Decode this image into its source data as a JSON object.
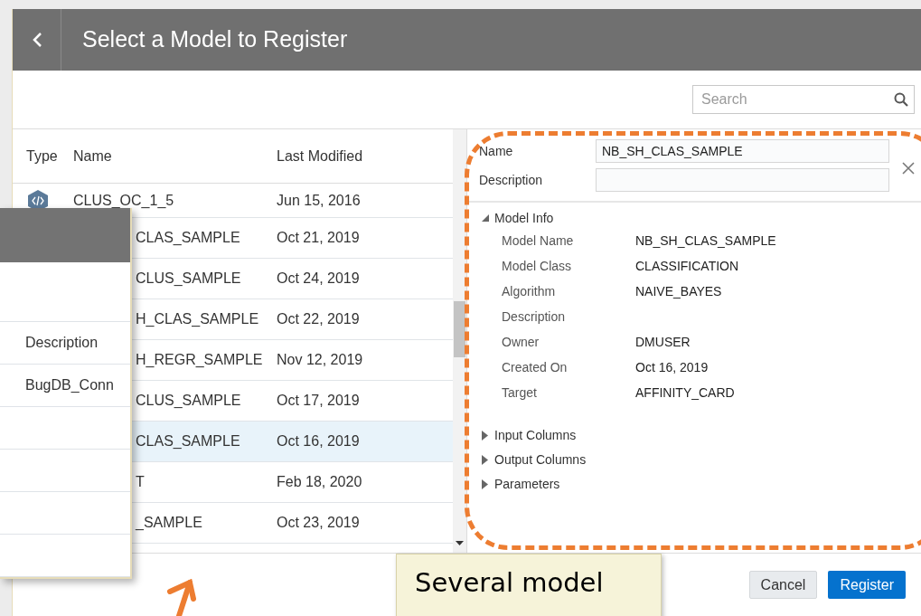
{
  "dialog": {
    "title": "Select a Model to Register"
  },
  "search": {
    "placeholder": "Search"
  },
  "table": {
    "columns": [
      "Type",
      "Name",
      "Last Modified"
    ],
    "rows": [
      {
        "type_icon": true,
        "name": "CLUS_OC_1_5",
        "modified": "Jun 15, 2016",
        "selected": false
      },
      {
        "type_icon": false,
        "name": "CLAS_SAMPLE",
        "modified": "Oct 21, 2019",
        "selected": false
      },
      {
        "type_icon": false,
        "name": "CLUS_SAMPLE",
        "modified": "Oct 24, 2019",
        "selected": false
      },
      {
        "type_icon": false,
        "name": "H_CLAS_SAMPLE",
        "modified": "Oct 22, 2019",
        "selected": false
      },
      {
        "type_icon": false,
        "name": "H_REGR_SAMPLE",
        "modified": "Nov 12, 2019",
        "selected": false
      },
      {
        "type_icon": false,
        "name": "CLUS_SAMPLE",
        "modified": "Oct 17, 2019",
        "selected": false
      },
      {
        "type_icon": false,
        "name": "CLAS_SAMPLE",
        "modified": "Oct 16, 2019",
        "selected": true
      },
      {
        "type_icon": false,
        "name": "T",
        "modified": "Feb 18, 2020",
        "selected": false
      },
      {
        "type_icon": false,
        "name": "_SAMPLE",
        "modified": "Oct 23, 2019",
        "selected": false
      }
    ]
  },
  "details": {
    "name_label": "Name",
    "name_value": "NB_SH_CLAS_SAMPLE",
    "description_label": "Description",
    "sections": [
      {
        "label": "Model Info",
        "expanded": true,
        "fields": [
          {
            "label": "Model Name",
            "value": "NB_SH_CLAS_SAMPLE"
          },
          {
            "label": "Model Class",
            "value": "CLASSIFICATION"
          },
          {
            "label": "Algorithm",
            "value": "NAIVE_BAYES"
          },
          {
            "label": "Description"
          },
          {
            "label": "Owner",
            "value": "DMUSER"
          },
          {
            "label": "Created On",
            "value": "Oct 16, 2019"
          },
          {
            "label": "Target",
            "value": "AFFINITY_CARD"
          }
        ]
      },
      {
        "label": "Input Columns",
        "expanded": false
      },
      {
        "label": "Output Columns",
        "expanded": false
      },
      {
        "label": "Parameters",
        "expanded": false
      }
    ]
  },
  "buttons": [
    {
      "label": "Cancel",
      "kind": "secondary"
    },
    {
      "label": "Register",
      "kind": "primary"
    }
  ],
  "overlay_panel": {
    "rows": [
      "",
      "Description",
      "BugDB_Conn",
      "",
      "",
      "",
      ""
    ]
  },
  "callout": {
    "text": "Several model"
  }
}
